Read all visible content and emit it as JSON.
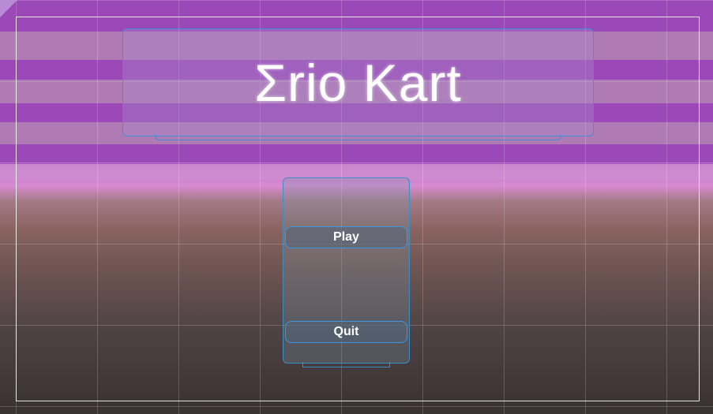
{
  "game": {
    "title": "Σrio Kart"
  },
  "menu": {
    "play_label": "Play",
    "quit_label": "Quit"
  },
  "colors": {
    "sky": "#9b49b8",
    "stripe": "#b483b4",
    "horizon_glow": "#d88ad2",
    "ground_top": "#8a6460",
    "ground_bottom": "#3a3133",
    "ui_outline": "#3f8fd6",
    "text": "#ffffff"
  }
}
